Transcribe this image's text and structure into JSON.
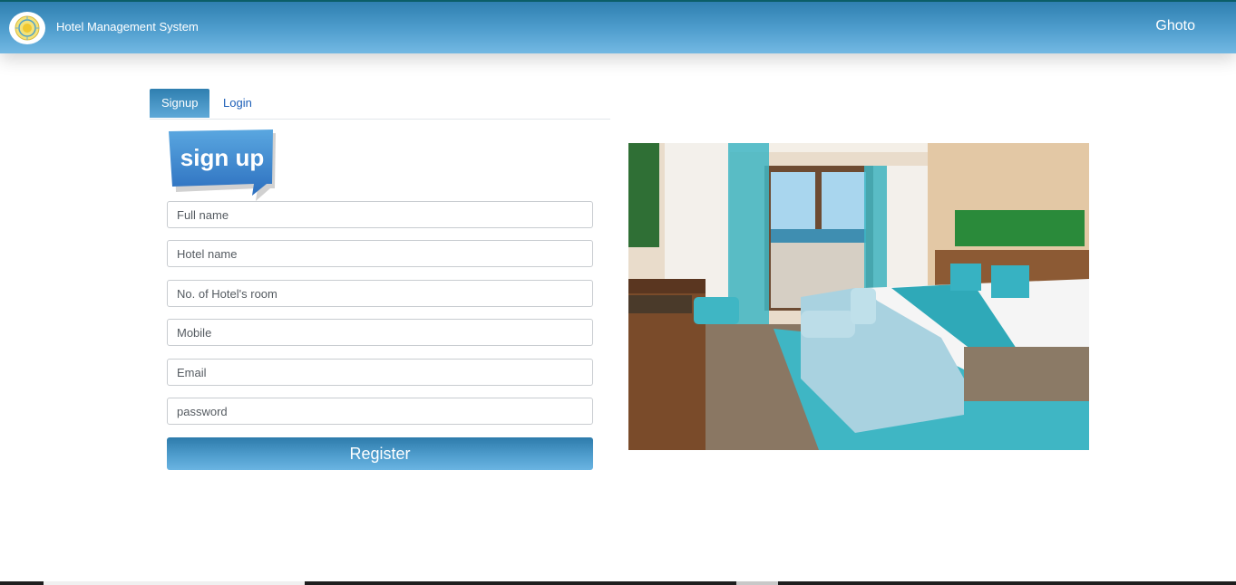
{
  "header": {
    "app_title": "Hotel Management System",
    "user_name": "Ghoto",
    "logo_icon": "hotel-logo-icon"
  },
  "tabs": [
    {
      "label": "Signup",
      "active": true
    },
    {
      "label": "Login",
      "active": false
    }
  ],
  "signup_badge": {
    "text": "sign up"
  },
  "form": {
    "fields": [
      {
        "placeholder": "Full name",
        "value": ""
      },
      {
        "placeholder": "Hotel name",
        "value": ""
      },
      {
        "placeholder": "No. of Hotel's room",
        "value": ""
      },
      {
        "placeholder": "Mobile",
        "value": ""
      },
      {
        "placeholder": "Email",
        "value": ""
      },
      {
        "placeholder": "password",
        "value": ""
      }
    ],
    "submit_label": "Register"
  },
  "colors": {
    "header_accent": "#4d9ccc",
    "link_blue": "#1d5fb8",
    "turquoise": "#3fb6c4"
  }
}
